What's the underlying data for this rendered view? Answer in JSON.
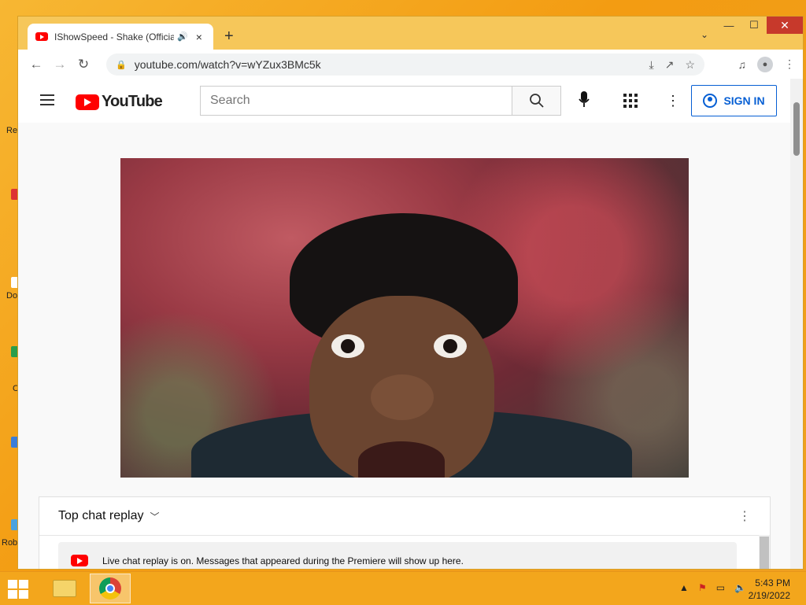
{
  "desktop": {
    "icon_labels": [
      "Re",
      "Do",
      "C",
      "Rob"
    ]
  },
  "browser": {
    "tab": {
      "title": "IShowSpeed - Shake (Official",
      "audio_icon": "speaker-icon",
      "close": "×"
    },
    "new_tab": "+",
    "tab_search": "⌄",
    "url": "youtube.com/watch?v=wYZux3BMc5k",
    "window_controls": {
      "minimize": "—",
      "maximize": "☐",
      "close": "✕"
    }
  },
  "youtube": {
    "logo_text": "YouTube",
    "search_placeholder": "Search",
    "sign_in_label": "SIGN IN",
    "brand_red": "#ff0000",
    "accent_blue": "#065fd4"
  },
  "chat": {
    "header": "Top chat replay",
    "banner_message": "Live chat replay is on. Messages that appeared during the Premiere will show up here."
  },
  "taskbar": {
    "time": "5:43 PM",
    "date": "2/19/2022"
  }
}
